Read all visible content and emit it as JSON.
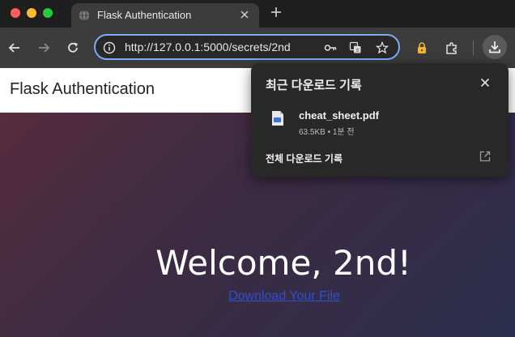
{
  "window": {
    "tab": {
      "title": "Flask Authentication",
      "favicon": "globe-icon"
    }
  },
  "toolbar": {
    "url": "http://127.0.0.1:5000/secrets/2nd",
    "icons": [
      "back-icon",
      "forward-icon",
      "reload-icon",
      "site-info-icon",
      "password-key-icon",
      "translate-icon",
      "bookmark-star-icon",
      "lock-icon",
      "extensions-icon",
      "download-icon"
    ]
  },
  "page": {
    "brand": "Flask Authentication",
    "heading": "Welcome, 2nd!",
    "link": "Download Your File"
  },
  "downloads": {
    "title": "최근 다운로드 기록",
    "items": [
      {
        "name": "cheat_sheet.pdf",
        "meta": "63.5KB • 1분 전"
      }
    ],
    "all_link": "전체 다운로드 기록"
  },
  "colors": {
    "omnibox_focus": "#7cacf8",
    "page_gradient_start": "#5a2d3c",
    "page_gradient_end": "#2d2f4e",
    "link": "#2f4fcc"
  }
}
